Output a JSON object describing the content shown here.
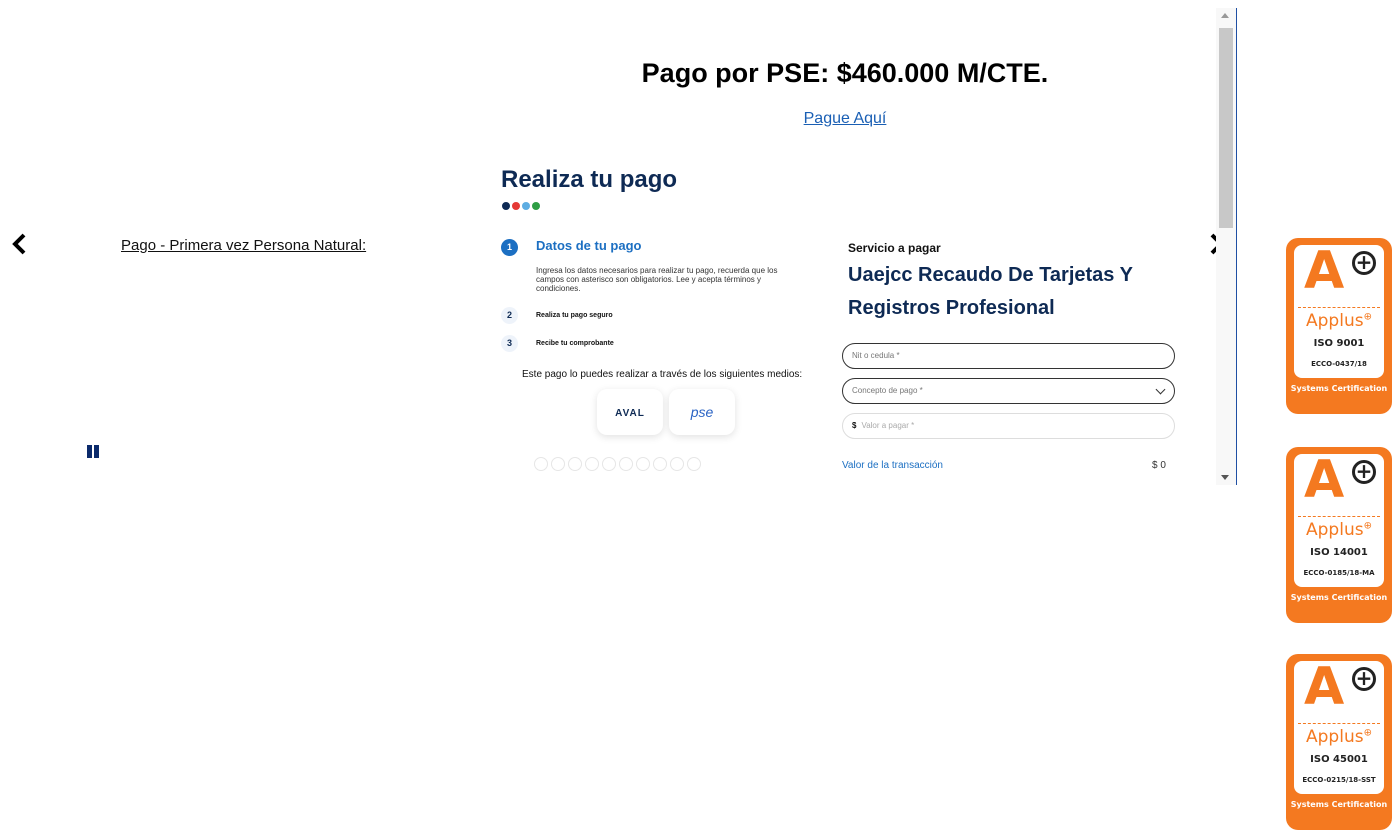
{
  "header": {
    "price_title": "Pago por PSE: $460.000 M/CTE.",
    "pay_link": "Pague Aquí"
  },
  "slider": {
    "slide_title": "Pago - Primera vez Persona Natural:",
    "left_arrow_icon": "chevron-left-icon",
    "right_arrow_icon": "chevron-right-icon",
    "pause_icon": "pause-icon"
  },
  "slide": {
    "heading": "Realiza tu pago",
    "dot_colors": [
      "#0e2a54",
      "#e53935",
      "#5dade2",
      "#2e9e44"
    ],
    "steps": [
      {
        "num": "1",
        "title": "Datos de tu pago",
        "desc": "Ingresa los datos necesarios para realizar tu pago, recuerda que los campos con asterisco son obligatorios. Lee y acepta términos y condiciones."
      },
      {
        "num": "2",
        "title": "Realiza tu pago seguro"
      },
      {
        "num": "3",
        "title": "Recibe tu comprobante"
      }
    ],
    "methods_text": "Este pago lo puedes realizar a través de los siguientes medios:",
    "methods": [
      {
        "label": "AVAL"
      },
      {
        "label": "pse"
      }
    ],
    "service_label": "Servicio a pagar",
    "service_name": "Uaejcc Recaudo De Tarjetas Y Registros Profesional",
    "fields": {
      "nit_placeholder": "Nit o cedula *",
      "concepto_placeholder": "Concepto de pago *",
      "valor_prefix": "$",
      "valor_placeholder": "Valor a pagar *"
    },
    "total_label": "Valor de la transacción",
    "total_value": "$ 0"
  },
  "badges": [
    {
      "brand": "Applus",
      "iso": "ISO 9001",
      "code": "ECCO-0437/18",
      "cert": "Systems Certification"
    },
    {
      "brand": "Applus",
      "iso": "ISO 14001",
      "code": "ECCO-0185/18-MA",
      "cert": "Systems Certification"
    },
    {
      "brand": "Applus",
      "iso": "ISO 45001",
      "code": "ECCO-0215/18-SST",
      "cert": "Systems Certification"
    }
  ],
  "colors": {
    "accent": "#1c6fc2",
    "navy": "#0e2a54",
    "badge_orange": "#f47920"
  }
}
